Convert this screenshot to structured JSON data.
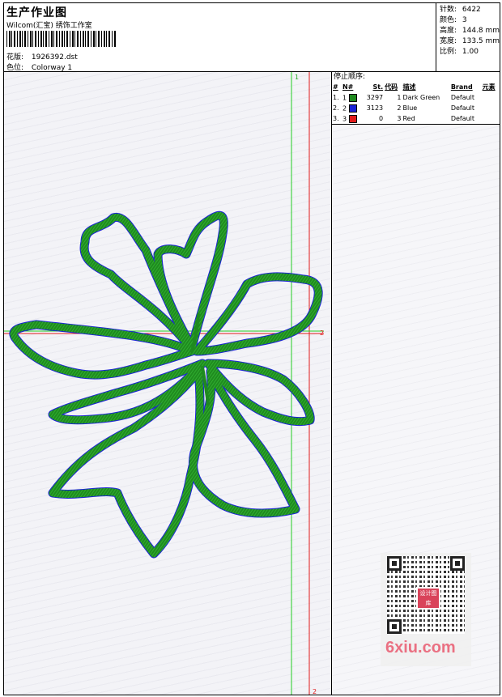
{
  "header": {
    "title": "生产作业图",
    "studio": "Wilcom(汇宝) 绣饰工作室",
    "design_label": "花版:",
    "design_value": "1926392.dst",
    "colorway_label": "色位:",
    "colorway_value": "Colorway 1"
  },
  "stats": [
    {
      "label": "针数:",
      "value": "6422"
    },
    {
      "label": "颜色:",
      "value": "3"
    },
    {
      "label": "高度:",
      "value": "144.8 mm"
    },
    {
      "label": "宽度:",
      "value": "133.5 mm"
    },
    {
      "label": "比例:",
      "value": "1.00"
    }
  ],
  "stop_sequence": {
    "title": "停止顺序:",
    "headers": [
      "#",
      "N#",
      "St.",
      "代码",
      "描述",
      "Brand",
      "元素"
    ],
    "rows": [
      {
        "idx": "1.",
        "n": "1",
        "color": "#1f8a1f",
        "stitches": "3297",
        "code": "1",
        "desc": "Dark Green",
        "brand": "Default"
      },
      {
        "idx": "2.",
        "n": "2",
        "color": "#1a23d6",
        "stitches": "3123",
        "code": "2",
        "desc": "Blue",
        "brand": "Default"
      },
      {
        "idx": "3.",
        "n": "3",
        "color": "#e01b1b",
        "stitches": "0",
        "code": "3",
        "desc": "Red",
        "brand": "Default"
      }
    ]
  },
  "guides": {
    "green_label": "1",
    "red_label_h": "2",
    "red_label_bottom": "2"
  },
  "colors": {
    "green_thread": "#1f8a1f",
    "blue_thread": "#1a23d6",
    "red_guide": "#e01b1b",
    "green_guide": "#22cc22"
  },
  "watermark": {
    "logo_text": "设计图库",
    "site": "6xiu.com"
  }
}
